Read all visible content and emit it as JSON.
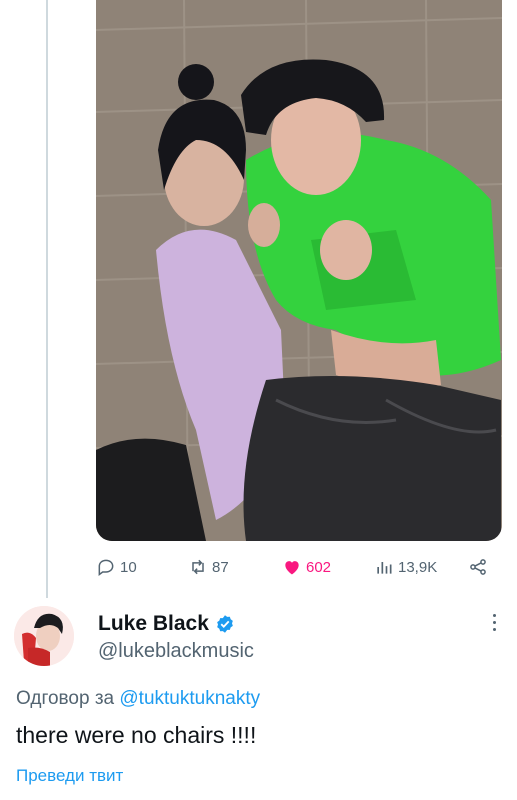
{
  "actions": {
    "replies": "10",
    "retweets": "87",
    "likes": "602",
    "views": "13,9K"
  },
  "colors": {
    "accent": "#1d9bf0",
    "like": "#f91880",
    "muted": "#536471",
    "text": "#0f1419"
  },
  "tweet": {
    "display_name": "Luke Black",
    "handle": "@lukeblackmusic",
    "reply_prefix": "Одговор за",
    "reply_mention": "@tuktuktuknakty",
    "text": "there were no chairs !!!!",
    "translate_label": "Преведи твит"
  },
  "icons": [
    "reply-icon",
    "retweet-icon",
    "heart-icon",
    "views-icon",
    "share-icon",
    "verified-badge-icon",
    "more-icon"
  ]
}
